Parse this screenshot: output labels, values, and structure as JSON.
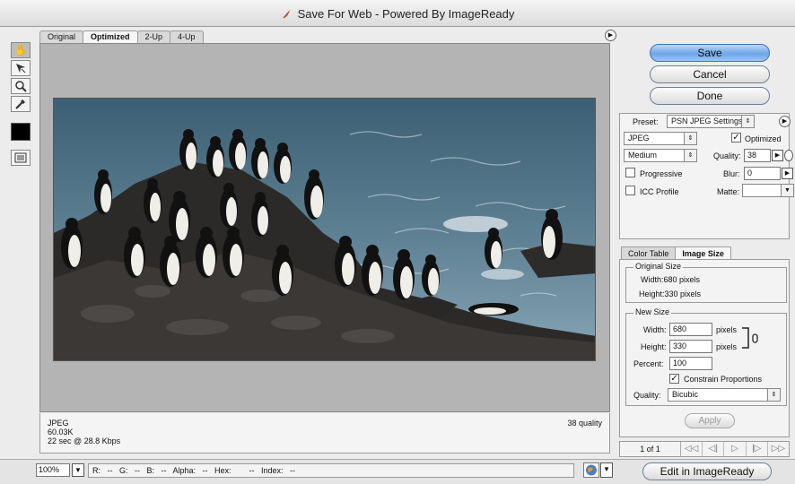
{
  "window": {
    "title": "Save For Web - Powered By ImageReady"
  },
  "tabs": [
    {
      "label": "Original",
      "active": false
    },
    {
      "label": "Optimized",
      "active": true
    },
    {
      "label": "2-Up",
      "active": false
    },
    {
      "label": "4-Up",
      "active": false
    }
  ],
  "tools": [
    "hand-tool",
    "slice-select-tool",
    "zoom-tool",
    "eyedropper-tool"
  ],
  "image_info": {
    "format": "JPEG",
    "size": "60.03K",
    "download_time": "22 sec @ 28.8 Kbps",
    "quality": "38 quality"
  },
  "buttons": {
    "save": "Save",
    "cancel": "Cancel",
    "done": "Done",
    "apply": "Apply",
    "edit": "Edit in ImageReady"
  },
  "settings": {
    "preset_label": "Preset:",
    "preset_value": "PSN JPEG Settings",
    "format": "JPEG",
    "optimized_label": "Optimized",
    "optimized_checked": true,
    "quality_level": "Medium",
    "quality_label": "Quality:",
    "quality_value": "38",
    "progressive_label": "Progressive",
    "progressive_checked": false,
    "blur_label": "Blur:",
    "blur_value": "0",
    "icc_label": "ICC Profile",
    "icc_checked": false,
    "matte_label": "Matte:",
    "matte_value": ""
  },
  "subtabs": [
    {
      "label": "Color Table",
      "active": false
    },
    {
      "label": "Image Size",
      "active": true
    }
  ],
  "original_size": {
    "title": "Original Size",
    "width": "Width:680 pixels",
    "height": "Height:330 pixels"
  },
  "new_size": {
    "title": "New Size",
    "width_label": "Width:",
    "width_value": "680",
    "height_label": "Height:",
    "height_value": "330",
    "unit": "pixels",
    "percent_label": "Percent:",
    "percent_value": "100",
    "constrain_label": "Constrain Proportions",
    "constrain_checked": true,
    "quality_label": "Quality:",
    "quality_value": "Bicubic"
  },
  "navigation": {
    "page": "1 of 1",
    "first": "◁◁",
    "prev": "◁|",
    "play": "▷",
    "next": "|▷",
    "last": "▷▷"
  },
  "status_bar": {
    "zoom": "100%",
    "readout": "R:   --   G:   --   B:   --   Alpha:   --   Hex:        --   Index:   --"
  },
  "icons": {
    "title": "imageready-feather-icon",
    "menu": "panel-menu-icon",
    "browser": "browser-preview-icon",
    "link": "chain-link-icon"
  }
}
